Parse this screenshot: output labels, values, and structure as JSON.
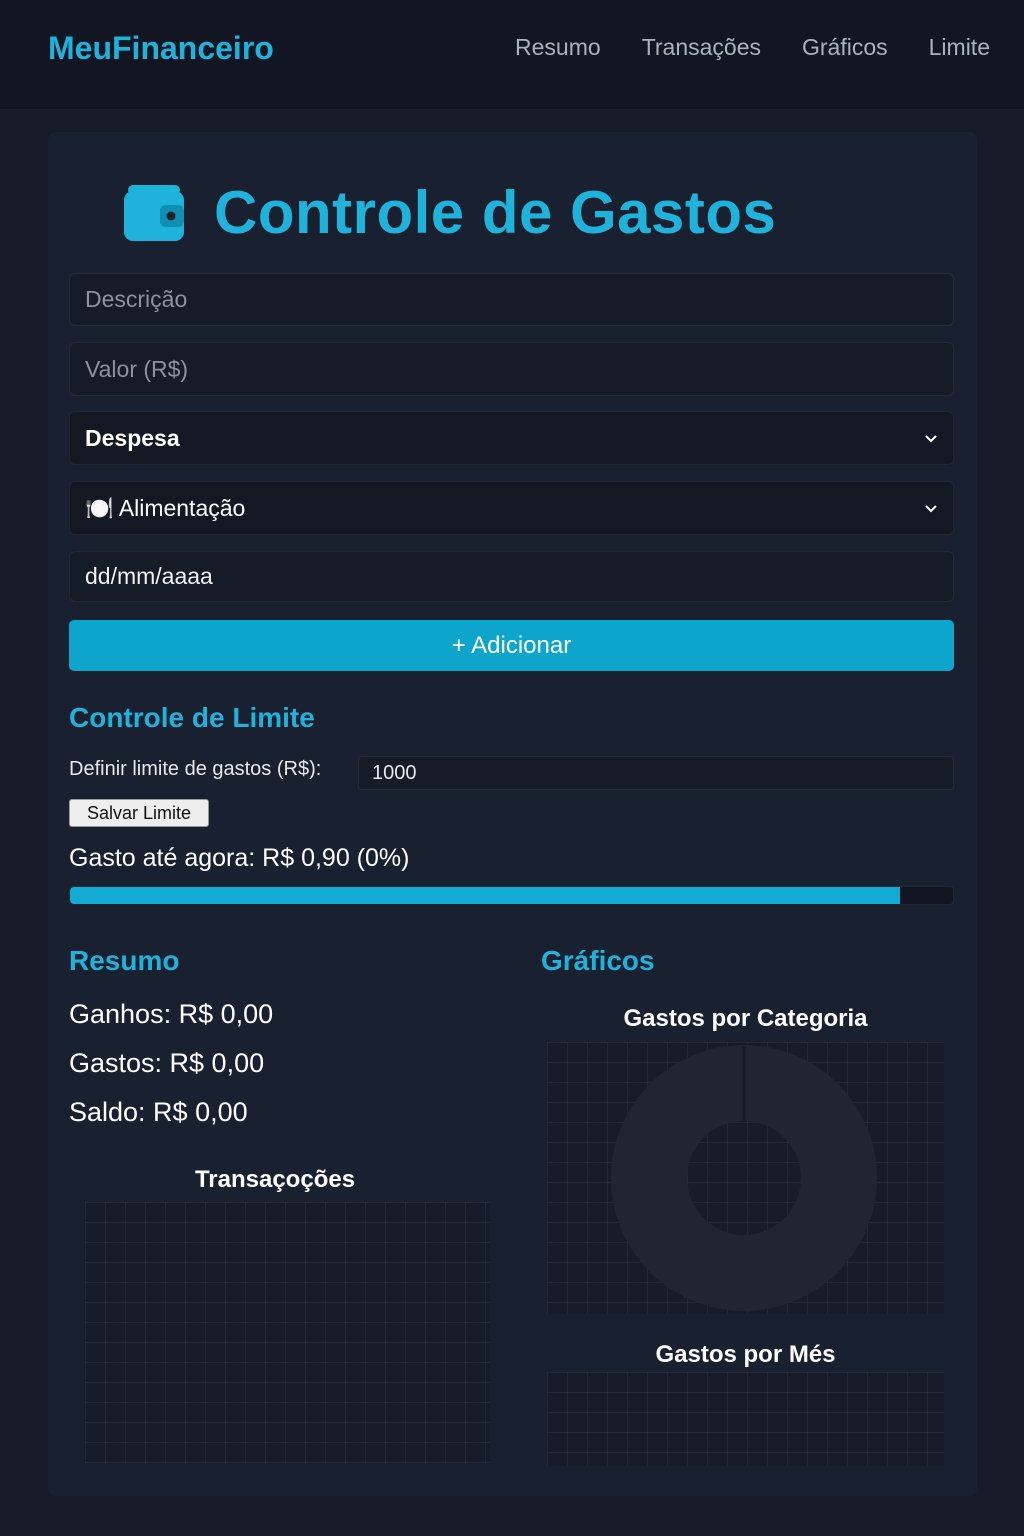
{
  "navbar": {
    "brand": "MeuFinanceiro",
    "links": [
      "Resumo",
      "Transações",
      "Gráficos",
      "Limite"
    ]
  },
  "header": {
    "title": "Controle de Gastos",
    "icon": "wallet-icon"
  },
  "form": {
    "description_placeholder": "Descrição",
    "value_placeholder": "Valor (R$)",
    "type_selected": "Despesa",
    "category_selected": "🍽️ Alimentação",
    "date_value": "dd/mm/aaaa",
    "add_label": "+ Adicionar"
  },
  "limit": {
    "title": "Controle de Limite",
    "label": "Definir limite de gastos (R$):",
    "input_value": "1000",
    "save_label": "Salvar Limite",
    "spent_text": "Gasto até agora: R$ 0,90 (0%)",
    "progress_fraction": 0.94
  },
  "summary": {
    "title": "Resumo",
    "income": "Ganhos: R$ 0,00",
    "expenses": "Gastos: R$ 0,00",
    "balance": "Saldo: R$ 0,00",
    "transactions_title": "Transaçoções"
  },
  "charts": {
    "title": "Gráficos",
    "category_title": "Gastos por Categoria",
    "month_title": "Gastos por Més"
  },
  "colors": {
    "accent": "#1fb3dc",
    "button": "#0ea5cc",
    "donut": "#1f2533"
  }
}
